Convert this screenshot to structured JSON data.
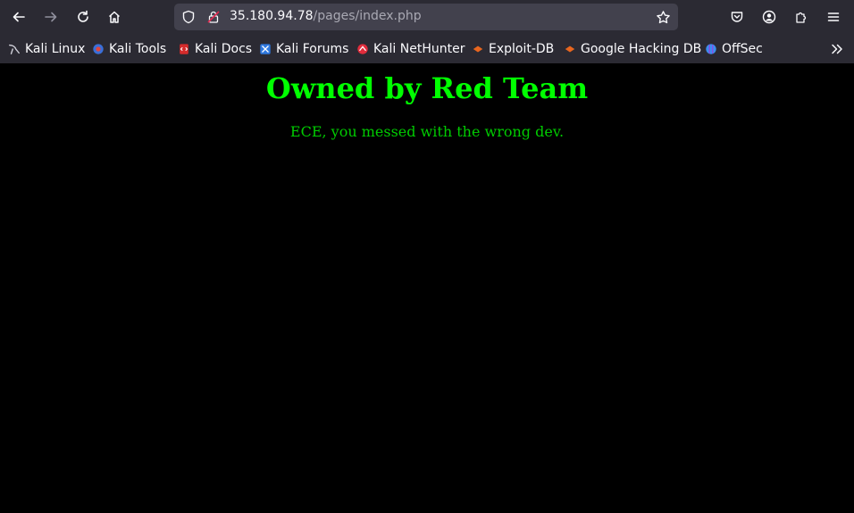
{
  "browser": {
    "url_host": "35.180.94.78",
    "url_path": "/pages/index.php",
    "bookmarks": [
      {
        "label": "Kali Linux",
        "icon": "kali-dragon-icon"
      },
      {
        "label": "Kali Tools",
        "icon": "kali-tools-icon"
      },
      {
        "label": "Kali Docs",
        "icon": "kali-docs-icon"
      },
      {
        "label": "Kali Forums",
        "icon": "kali-forums-icon"
      },
      {
        "label": "Kali NetHunter",
        "icon": "nethunter-icon"
      },
      {
        "label": "Exploit-DB",
        "icon": "exploit-db-icon"
      },
      {
        "label": "Google Hacking DB",
        "icon": "ghdb-icon"
      },
      {
        "label": "OffSec",
        "icon": "offsec-icon"
      }
    ]
  },
  "page": {
    "heading": "Owned by Red Team",
    "message": "ECE, you messed with the wrong dev."
  },
  "colors": {
    "heading": "#00ff00",
    "message": "#00cc00",
    "background": "#000000",
    "chrome": "#2b2a33"
  }
}
